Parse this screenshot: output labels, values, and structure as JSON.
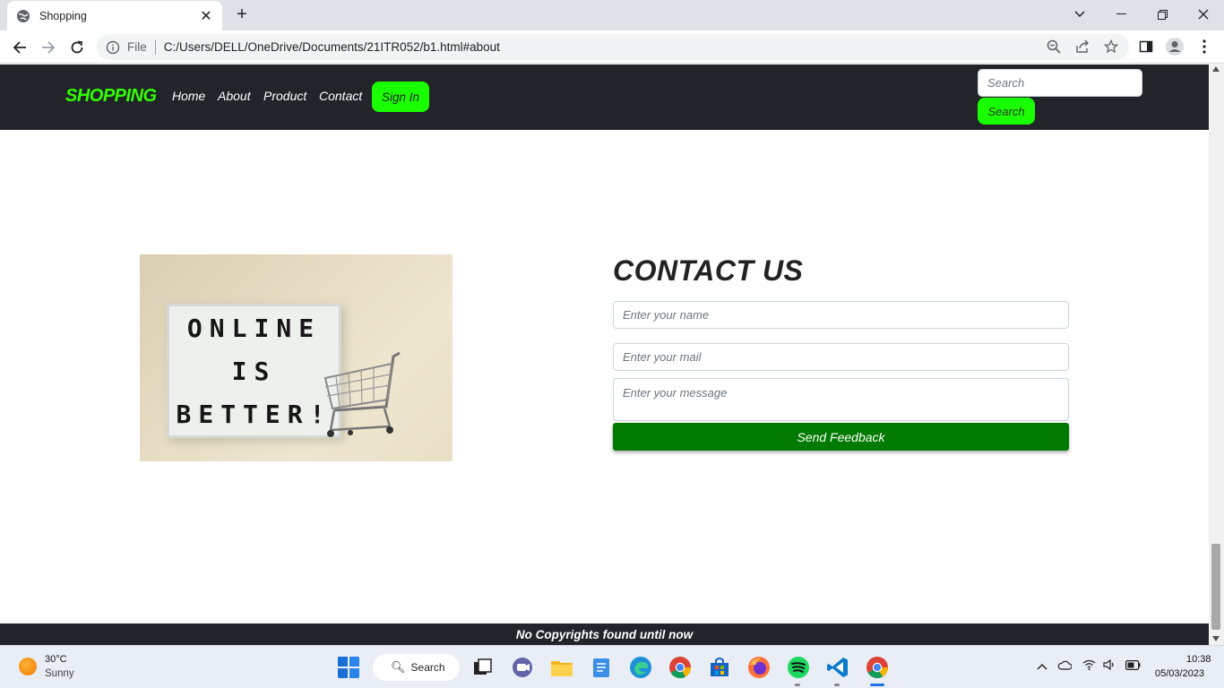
{
  "browser": {
    "tab_title": "Shopping",
    "tab_close": "✕",
    "new_tab": "+",
    "scheme_label": "File",
    "url": "C:/Users/DELL/OneDrive/Documents/21ITR052/b1.html#about"
  },
  "site": {
    "brand": "SHOPPING",
    "nav": [
      "Home",
      "About",
      "Product",
      "Contact"
    ],
    "signin_label": "Sign In",
    "search_placeholder": "Search",
    "search_button": "Search",
    "image_text": [
      "ONLINE",
      "IS",
      "BETTER!"
    ],
    "contact": {
      "title": "CONTACT US",
      "name_placeholder": "Enter your name",
      "mail_placeholder": "Enter your mail",
      "message_placeholder": "Enter your message",
      "send_label": "Send Feedback"
    },
    "footer": "No Copyrights found until now",
    "colors": {
      "navbar": "#212529",
      "brand": "#32ff00",
      "accent_button": "#1aff00",
      "send_button": "#007a00"
    }
  },
  "taskbar": {
    "temperature": "30°C",
    "condition": "Sunny",
    "search_label": "Search",
    "time": "10:38",
    "date": "05/03/2023"
  }
}
